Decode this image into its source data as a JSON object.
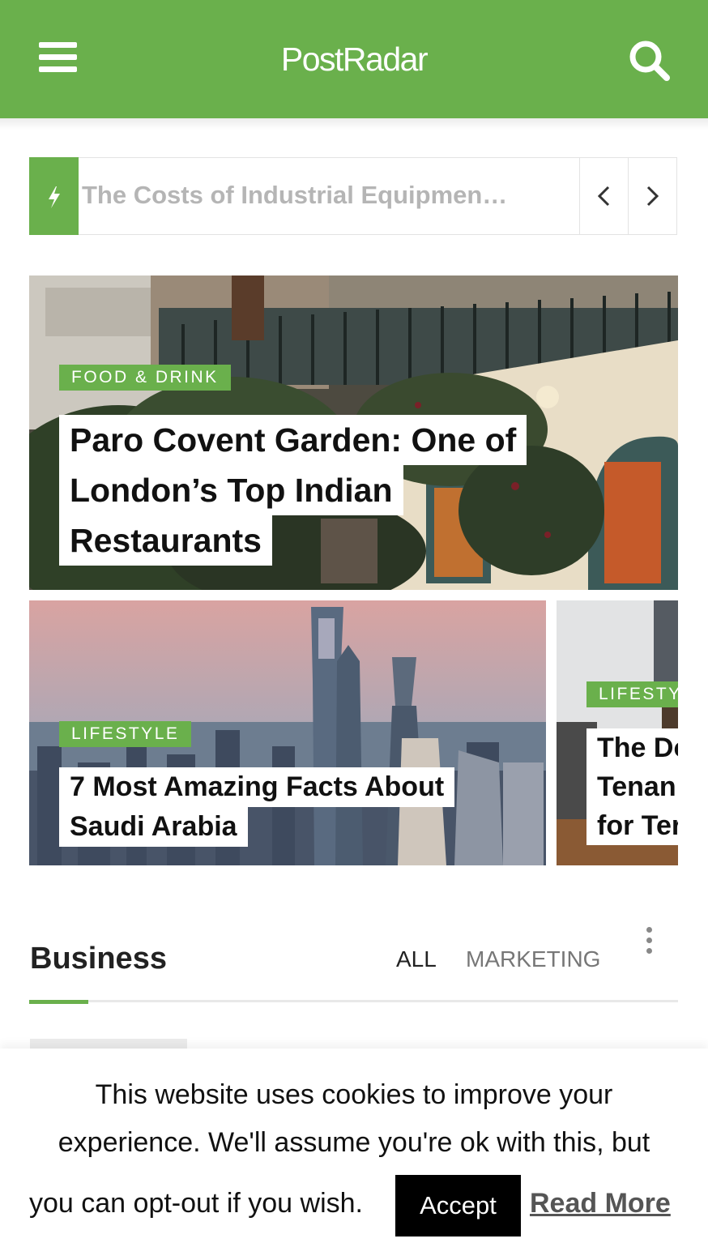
{
  "header": {
    "logo": "PostRadar",
    "menu_icon": "hamburger-menu-icon",
    "search_icon": "search-icon",
    "color": "#6ab04c"
  },
  "ticker": {
    "headline": "The Costs of Industrial Equipmen…",
    "badge_icon": "lightning-bolt-icon",
    "prev_icon": "chevron-left-icon",
    "next_icon": "chevron-right-icon"
  },
  "featured": {
    "category": "FOOD & DRINK",
    "title_lines": [
      "Paro Covent Garden: One of",
      "London’s Top Indian",
      "Restaurants"
    ]
  },
  "slider": [
    {
      "category": "LIFESTYLE",
      "title_lines": [
        "7 Most Amazing Facts About",
        "Saudi Arabia"
      ]
    },
    {
      "category": "LIFESTYLE",
      "title_lines": [
        "The Do",
        "Tenan",
        "for Ter"
      ]
    }
  ],
  "business": {
    "title": "Business",
    "filters": [
      "ALL",
      "MARKETING"
    ],
    "more_icon": "more-vertical-icon"
  },
  "cookie": {
    "line1": "This website uses cookies to improve your",
    "line2": "experience. We'll assume you're ok with this, but",
    "line3": "you can opt-out if you wish.",
    "accept": "Accept",
    "read_more": "Read More"
  }
}
